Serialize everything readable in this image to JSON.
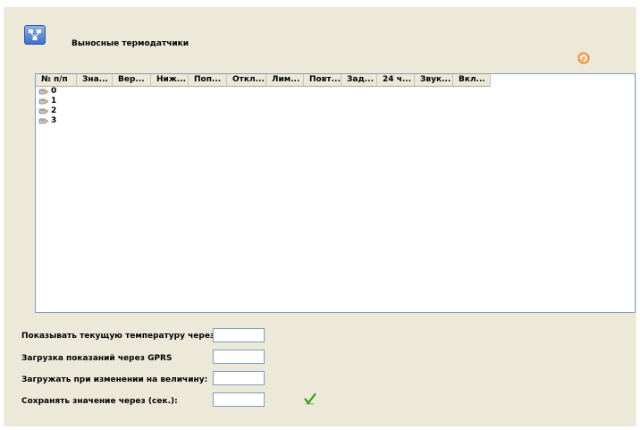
{
  "header": {
    "title": "Выносные термодатчики"
  },
  "icons": {
    "app": "network-icon",
    "refresh": "refresh-icon",
    "sensor": "sensor-icon",
    "save": "checkmark-icon"
  },
  "colors": {
    "panel_bg": "#ece9d8",
    "field_border": "#7f9db9",
    "refresh": "#e8772a",
    "check": "#3a9a1e"
  },
  "table": {
    "columns": [
      "№ п/п",
      "Зна...",
      "Вер...",
      "Ниж...",
      "Поп...",
      "Откл...",
      "Лим...",
      "Повт...",
      "Зад...",
      "24 ч...",
      "Звук...",
      "Вкл..."
    ],
    "rows": [
      "0",
      "1",
      "2",
      "3"
    ]
  },
  "form": {
    "show_temp_label": "Показывать текущую температуру через",
    "show_temp_value": "",
    "gprs_label": "Загрузка показаний через GPRS",
    "gprs_value": "",
    "on_change_label": "Загружать при изменении на величину:",
    "on_change_value": "",
    "save_interval_label": "Сохранять значение через (сек.):",
    "save_interval_value": ""
  }
}
